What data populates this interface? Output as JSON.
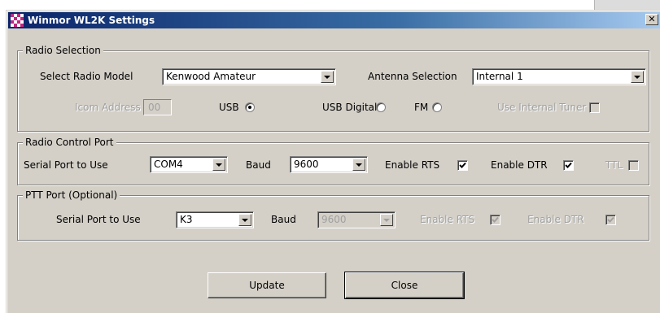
{
  "window": {
    "title": "Winmor WL2K Settings",
    "close_glyph": "✕"
  },
  "radio_selection": {
    "legend": "Radio Selection",
    "model_label": "Select Radio Model",
    "model_value": "Kenwood Amateur",
    "antenna_label": "Antenna Selection",
    "antenna_value": "Internal 1",
    "icom_label": "Icom Address",
    "icom_value": "00",
    "modes": [
      {
        "label": "USB",
        "selected": true
      },
      {
        "label": "USB Digital",
        "selected": false
      },
      {
        "label": "FM",
        "selected": false
      }
    ],
    "tuner_label": "Use Internal Tuner",
    "tuner_checked": false
  },
  "control_port": {
    "legend": "Radio Control Port",
    "port_label": "Serial Port to Use",
    "port_value": "COM4",
    "baud_label": "Baud",
    "baud_value": "9600",
    "rts_label": "Enable RTS",
    "rts_checked": true,
    "dtr_label": "Enable DTR",
    "dtr_checked": true,
    "ttl_label": "TTL",
    "ttl_checked": false
  },
  "ptt_port": {
    "legend": "PTT Port (Optional)",
    "port_label": "Serial Port to Use",
    "port_value": "K3",
    "baud_label": "Baud",
    "baud_value": "9600",
    "rts_label": "Enable RTS",
    "rts_checked": true,
    "dtr_label": "Enable DTR",
    "dtr_checked": true
  },
  "buttons": {
    "update": "Update",
    "close": "Close"
  },
  "colors": {
    "face": "#d4d0c8",
    "title_start": "#0a246a",
    "title_end": "#a6caf0"
  }
}
